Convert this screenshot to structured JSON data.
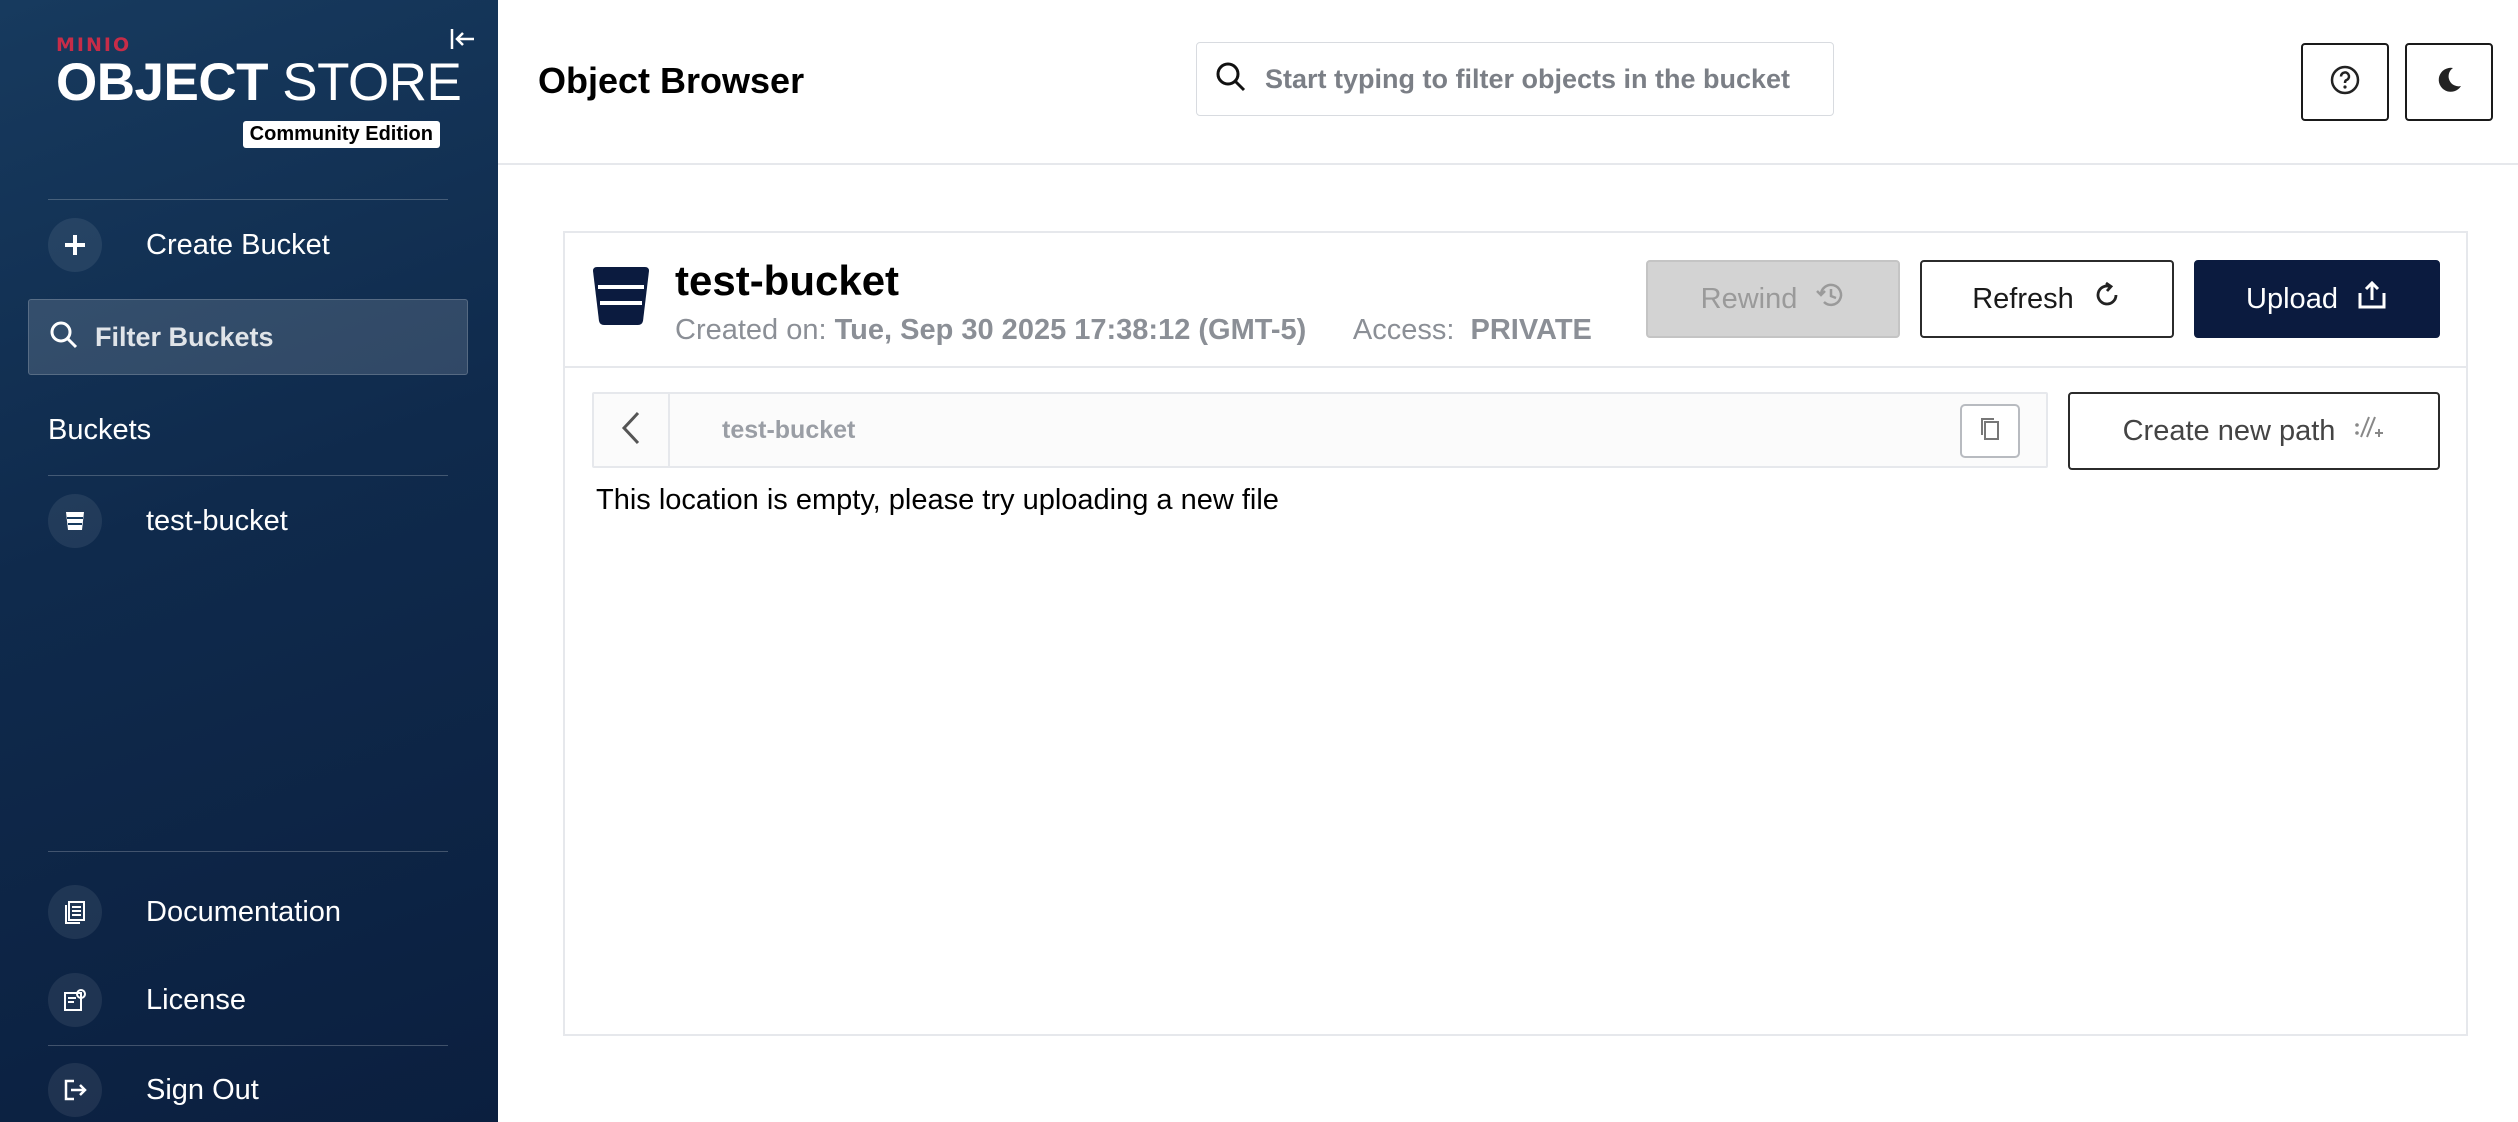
{
  "sidebar": {
    "logo": {
      "brand": "MINIO",
      "title_bold": "OBJECT",
      "title_thin": "STORE",
      "edition": "Community Edition"
    },
    "create_bucket": "Create Bucket",
    "filter_placeholder": "Filter Buckets",
    "section_title": "Buckets",
    "buckets": [
      {
        "label": "test-bucket"
      }
    ],
    "bottom_items": [
      {
        "label": "Documentation",
        "icon": "documentation-icon"
      },
      {
        "label": "License",
        "icon": "license-icon"
      },
      {
        "label": "Sign Out",
        "icon": "sign-out-icon"
      }
    ]
  },
  "header": {
    "title": "Object Browser",
    "search_placeholder": "Start typing to filter objects in the bucket",
    "help_icon": "help-icon",
    "theme_icon": "dark-mode-icon"
  },
  "bucket": {
    "name": "test-bucket",
    "created_label": "Created on:",
    "created_value": "Tue, Sep 30 2025 17:38:12 (GMT-5)",
    "access_label": "Access:",
    "access_value": "PRIVATE"
  },
  "actions": {
    "rewind": "Rewind",
    "refresh": "Refresh",
    "upload": "Upload",
    "create_path": "Create new path"
  },
  "browser": {
    "path": "test-bucket",
    "empty_message": "This location is empty, please try uploading a new file"
  },
  "colors": {
    "sidebar_bg": "#0f2a4c",
    "brand_red": "#c72c48",
    "upload_bg": "#0b1b3f",
    "rewind_bg": "#d3d3d3"
  }
}
